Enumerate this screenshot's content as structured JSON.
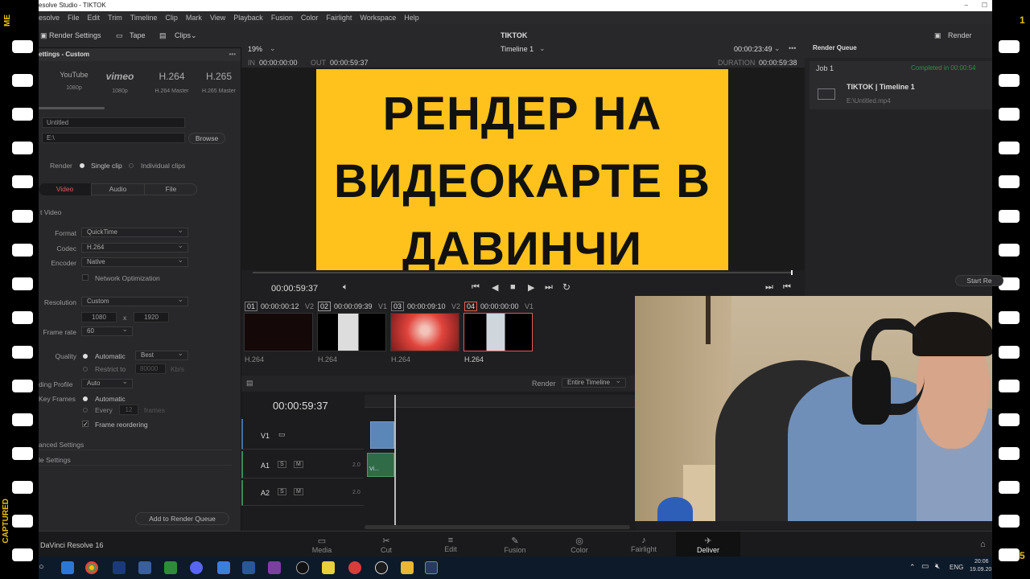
{
  "window": {
    "title": "esolve Studio - TIKTOK"
  },
  "menu": [
    "esolve",
    "File",
    "Edit",
    "Trim",
    "Timeline",
    "Clip",
    "Mark",
    "View",
    "Playback",
    "Fusion",
    "Color",
    "Fairlight",
    "Workspace",
    "Help"
  ],
  "toolbar": {
    "render_settings": "Render Settings",
    "tape": "Tape",
    "clips": "Clips",
    "project": "TIKTOK",
    "render_queue": "Render Queue"
  },
  "settings": {
    "header": "ettings - Custom",
    "presets": [
      {
        "name": "YouTube",
        "sub": "1080p"
      },
      {
        "name": "vimeo",
        "sub": "1080p"
      },
      {
        "name": "H.264",
        "sub": "H.264 Master"
      },
      {
        "name": "H.265",
        "sub": "H.265 Master"
      }
    ],
    "filename": "Untitled",
    "location": "E:\\",
    "browse": "Browse",
    "render_label": "Render",
    "single_clip": "Single clip",
    "individual_clips": "Individual clips",
    "tabs": [
      "Video",
      "Audio",
      "File"
    ],
    "export_video": "t Video",
    "format_label": "Format",
    "format": "QuickTime",
    "codec_label": "Codec",
    "codec": "H.264",
    "encoder_label": "Encoder",
    "encoder": "Native",
    "network_opt": "Network Optimization",
    "resolution_label": "Resolution",
    "resolution": "Custom",
    "width": "1080",
    "x": "x",
    "height": "1920",
    "framerate_label": "Frame rate",
    "framerate": "60",
    "quality_label": "Quality",
    "automatic": "Automatic",
    "best": "Best",
    "restrict": "Restrict to",
    "restrict_val": "80000",
    "kbs": "Kb/s",
    "profile_label": "ding Profile",
    "profile": "Auto",
    "keyframes_label": "Key Frames",
    "kf_auto": "Automatic",
    "every": "Every",
    "every_val": "12",
    "frames": "frames",
    "frame_reordering": "Frame reordering",
    "advanced": "anced Settings",
    "file_settings": "le Settings",
    "add_queue": "Add to Render Queue"
  },
  "viewer": {
    "zoom": "19%",
    "timeline_name": "Timeline 1",
    "timecode_top": "00:00:23:49",
    "in_label": "IN",
    "in_tc": "00:00:00:00",
    "out_label": "OUT",
    "out_tc": "00:00:59:37",
    "duration_label": "DURATION",
    "duration_tc": "00:00:59:38",
    "current_tc": "00:00:59:37"
  },
  "thumbnail_text": [
    "РЕНДЕР НА",
    "ВИДЕОКАРТЕ В",
    "ДАВИНЧИ"
  ],
  "clips": [
    {
      "num": "01",
      "tc": "00:00:00:12",
      "track": "V2",
      "codec": "H.264"
    },
    {
      "num": "02",
      "tc": "00:00:09:39",
      "track": "V1",
      "codec": "H.264"
    },
    {
      "num": "03",
      "tc": "00:00:09:10",
      "track": "V2",
      "codec": "H.264"
    },
    {
      "num": "04",
      "tc": "00:00:00:00",
      "track": "V1",
      "codec": "H.264"
    }
  ],
  "timeline": {
    "render_label": "Render",
    "render_mode": "Entire Timeline",
    "tc": "00:00:59:37",
    "tracks": [
      {
        "name": "V1"
      },
      {
        "name": "A1",
        "level": "2.0"
      },
      {
        "name": "A2",
        "level": "2.0"
      }
    ],
    "s": "S",
    "m": "M",
    "audio_clip": "Vi..."
  },
  "render_queue": {
    "title": "Render Queue",
    "job": "Job 1",
    "status": "Completed in 00:00:54",
    "item": "TIKTOK | Timeline 1",
    "path": "E:\\Untitled.mp4",
    "start": "Start Re"
  },
  "pages": [
    {
      "name": "Media",
      "icon": "▭"
    },
    {
      "name": "Cut",
      "icon": "✂"
    },
    {
      "name": "Edit",
      "icon": "≡"
    },
    {
      "name": "Fusion",
      "icon": "✎"
    },
    {
      "name": "Color",
      "icon": "◎"
    },
    {
      "name": "Fairlight",
      "icon": "♪"
    },
    {
      "name": "Deliver",
      "icon": "✈"
    }
  ],
  "app_name": "DaVinci Resolve 16",
  "taskbar": {
    "lang": "ENG",
    "time": "20:06",
    "date": "19.09.20"
  },
  "film": {
    "left_top": "ME",
    "left_bottom": "CAPTURED",
    "right_top": "1",
    "right_bottom": "5"
  }
}
